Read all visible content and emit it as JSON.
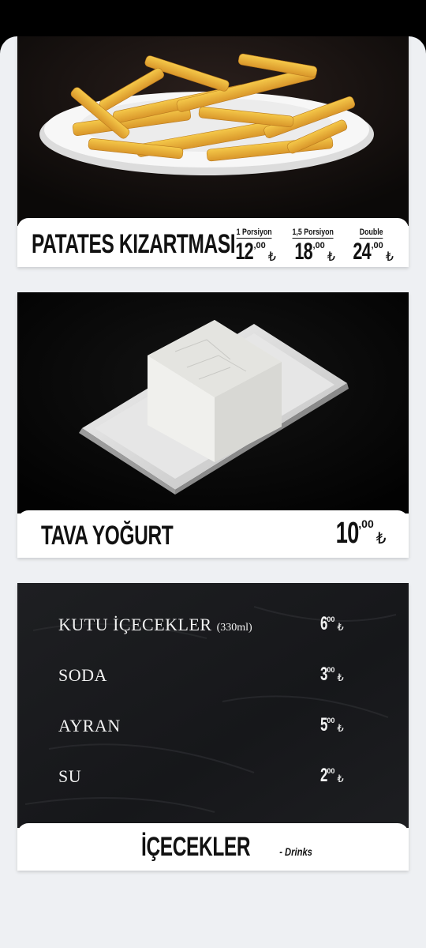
{
  "items": [
    {
      "name": "PATATES KIZARTMASI",
      "prices": [
        {
          "label": "1 Porsiyon",
          "int": "12",
          "dec": ",00",
          "currency": "₺"
        },
        {
          "label": "1,5 Porsiyon",
          "int": "18",
          "dec": ",00",
          "currency": "₺"
        },
        {
          "label": "Double",
          "int": "24",
          "dec": ",00",
          "currency": "₺"
        }
      ]
    },
    {
      "name": "TAVA YOĞURT",
      "price": {
        "int": "10",
        "dec": ",00",
        "currency": "₺"
      }
    }
  ],
  "drinks": {
    "title": "İÇECEKLER",
    "subtitle": "- Drinks",
    "list": [
      {
        "name": "KUTU İÇECEKLER",
        "note": "(330ml)",
        "int": "6",
        "dec": "00",
        "currency": "₺"
      },
      {
        "name": "SODA",
        "note": "",
        "int": "3",
        "dec": "00",
        "currency": "₺"
      },
      {
        "name": "AYRAN",
        "note": "",
        "int": "5",
        "dec": "00",
        "currency": "₺"
      },
      {
        "name": "SU",
        "note": "",
        "int": "2",
        "dec": "00",
        "currency": "₺"
      }
    ]
  },
  "colors": {
    "background": "#eef0f3",
    "dark": "#111111",
    "card": "#ffffff"
  },
  "icons": [
    "fries-photo",
    "yogurt-photo",
    "chalkboard-texture"
  ]
}
